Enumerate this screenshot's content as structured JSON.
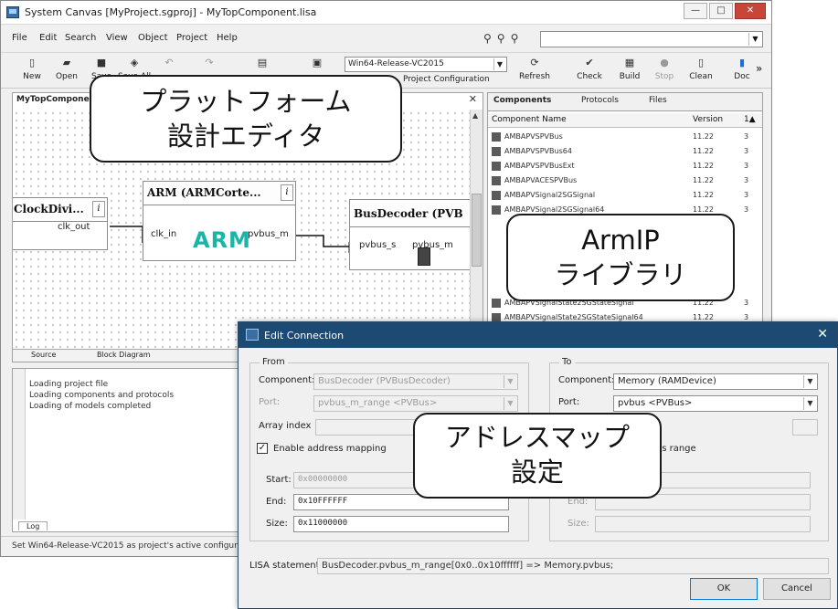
{
  "window": {
    "title": "System Canvas [MyProject.sgproj] - MyTopComponent.lisa",
    "buttons": {
      "minimize": "—",
      "maximize": "□",
      "close": "✕"
    }
  },
  "menu": [
    "File",
    "Edit",
    "Search",
    "View",
    "Object",
    "Project",
    "Help"
  ],
  "toolbar": {
    "buttons": [
      "New",
      "Open",
      "Save",
      "Save All",
      "",
      "",
      "",
      "",
      "Refresh",
      "Check",
      "Build",
      "Stop",
      "Clean",
      "Doc"
    ],
    "config_value": "Win64-Release-VC2015",
    "config_label": "Project Configuration",
    "overflow": "»"
  },
  "editor": {
    "tab_label": "MyTopComponent",
    "close": "✕",
    "bottom_tabs": [
      "Source",
      "Block Diagram"
    ],
    "components": {
      "clock": {
        "title": "ClockDivi...",
        "info": "i",
        "port": "clk_out"
      },
      "arm": {
        "title": "ARM (ARMCorte...",
        "info": "i",
        "port_in": "clk_in",
        "port_out": "pvbus_m",
        "logo": "ARM"
      },
      "bus": {
        "title": "BusDecoder (PVB",
        "port_in": "pvbus_s",
        "port_out": "pvbus_m"
      }
    }
  },
  "components_panel": {
    "tabs": [
      "Components",
      "Protocols",
      "Files"
    ],
    "columns": [
      "Component Name",
      "Version",
      "1▲"
    ],
    "rows": [
      {
        "name": "AMBAPVSPVBus",
        "version": "11.22",
        "extra": "3"
      },
      {
        "name": "AMBAPVSPVBus64",
        "version": "11.22",
        "extra": "3"
      },
      {
        "name": "AMBAPVSPVBusExt",
        "version": "11.22",
        "extra": "3"
      },
      {
        "name": "AMBAPVACESPVBus",
        "version": "11.22",
        "extra": "3"
      },
      {
        "name": "AMBAPVSignal2SGSignal",
        "version": "11.22",
        "extra": "3"
      },
      {
        "name": "AMBAPVSignal2SGSignal64",
        "version": "11.22",
        "extra": "3"
      },
      {
        "name": "AMBAPVSignalState2SGStateSignal",
        "version": "11.22",
        "extra": "3"
      },
      {
        "name": "AMBAPVSignalState2SGStateSignal64",
        "version": "11.22",
        "extra": "3"
      }
    ]
  },
  "log": {
    "lines": [
      "Loading project file",
      "Loading components and protocols",
      "Loading of models completed"
    ],
    "tab": "Log"
  },
  "status": "Set Win64-Release-VC2015 as project's active configuration",
  "dialog": {
    "title": "Edit Connection",
    "close": "✕",
    "from": {
      "group": "From",
      "component_label": "Component:",
      "component_value": "BusDecoder (PVBusDecoder)",
      "port_label": "Port:",
      "port_value": "pvbus_m_range <PVBus>",
      "array_label": "Array index",
      "enable_label": "Enable address mapping",
      "start_label": "Start:",
      "start_value": "0x00000000",
      "end_label": "End:",
      "end_value": "0x10FFFFFF",
      "size_label": "Size:",
      "size_value": "0x11000000"
    },
    "to": {
      "group": "To",
      "component_label": "Component:",
      "component_value": "Memory (RAMDevice)",
      "port_label": "Port:",
      "port_value": "pvbus <PVBus>",
      "range_label": "ss range",
      "end_label": "End:",
      "size_label": "Size:"
    },
    "lisa_label": "LISA statement:",
    "lisa_value": "BusDecoder.pvbus_m_range[0x0..0x10ffffff] => Memory.pvbus;",
    "ok": "OK",
    "cancel": "Cancel"
  },
  "callouts": {
    "platform_line1": "プラットフォーム",
    "platform_line2": "設計エディタ",
    "armip_line1": "ArmIP",
    "armip_line2": "ライブラリ",
    "addr_line1": "アドレスマップ",
    "addr_line2": "設定"
  }
}
